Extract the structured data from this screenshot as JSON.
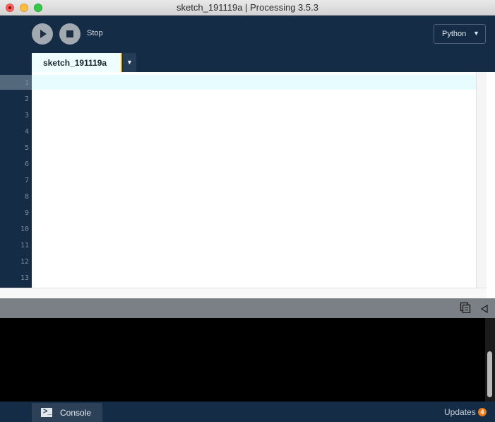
{
  "window": {
    "title": "sketch_191119a | Processing 3.5.3"
  },
  "toolbar": {
    "stop_label": "Stop",
    "mode": "Python",
    "mode_arrow": "▼"
  },
  "tabs": [
    {
      "label": "sketch_191119a"
    }
  ],
  "tab_menu_arrow": "▼",
  "editor": {
    "line_numbers": [
      "1",
      "2",
      "3",
      "4",
      "5",
      "6",
      "7",
      "8",
      "9",
      "10",
      "11",
      "12",
      "13"
    ],
    "current_line": 1
  },
  "console": {
    "tab_label": "Console"
  },
  "footer": {
    "updates_label": "Updates",
    "updates_count": "4"
  },
  "icons": {
    "run": "play-icon",
    "stop": "stop-icon",
    "copy": "copy-icon",
    "collapse": "collapse-arrow-icon",
    "console": "terminal-icon"
  },
  "colors": {
    "background": "#142c45",
    "tab_accent": "#e0a312",
    "current_line": "#e6fcfe",
    "badge": "#ea7b17"
  }
}
